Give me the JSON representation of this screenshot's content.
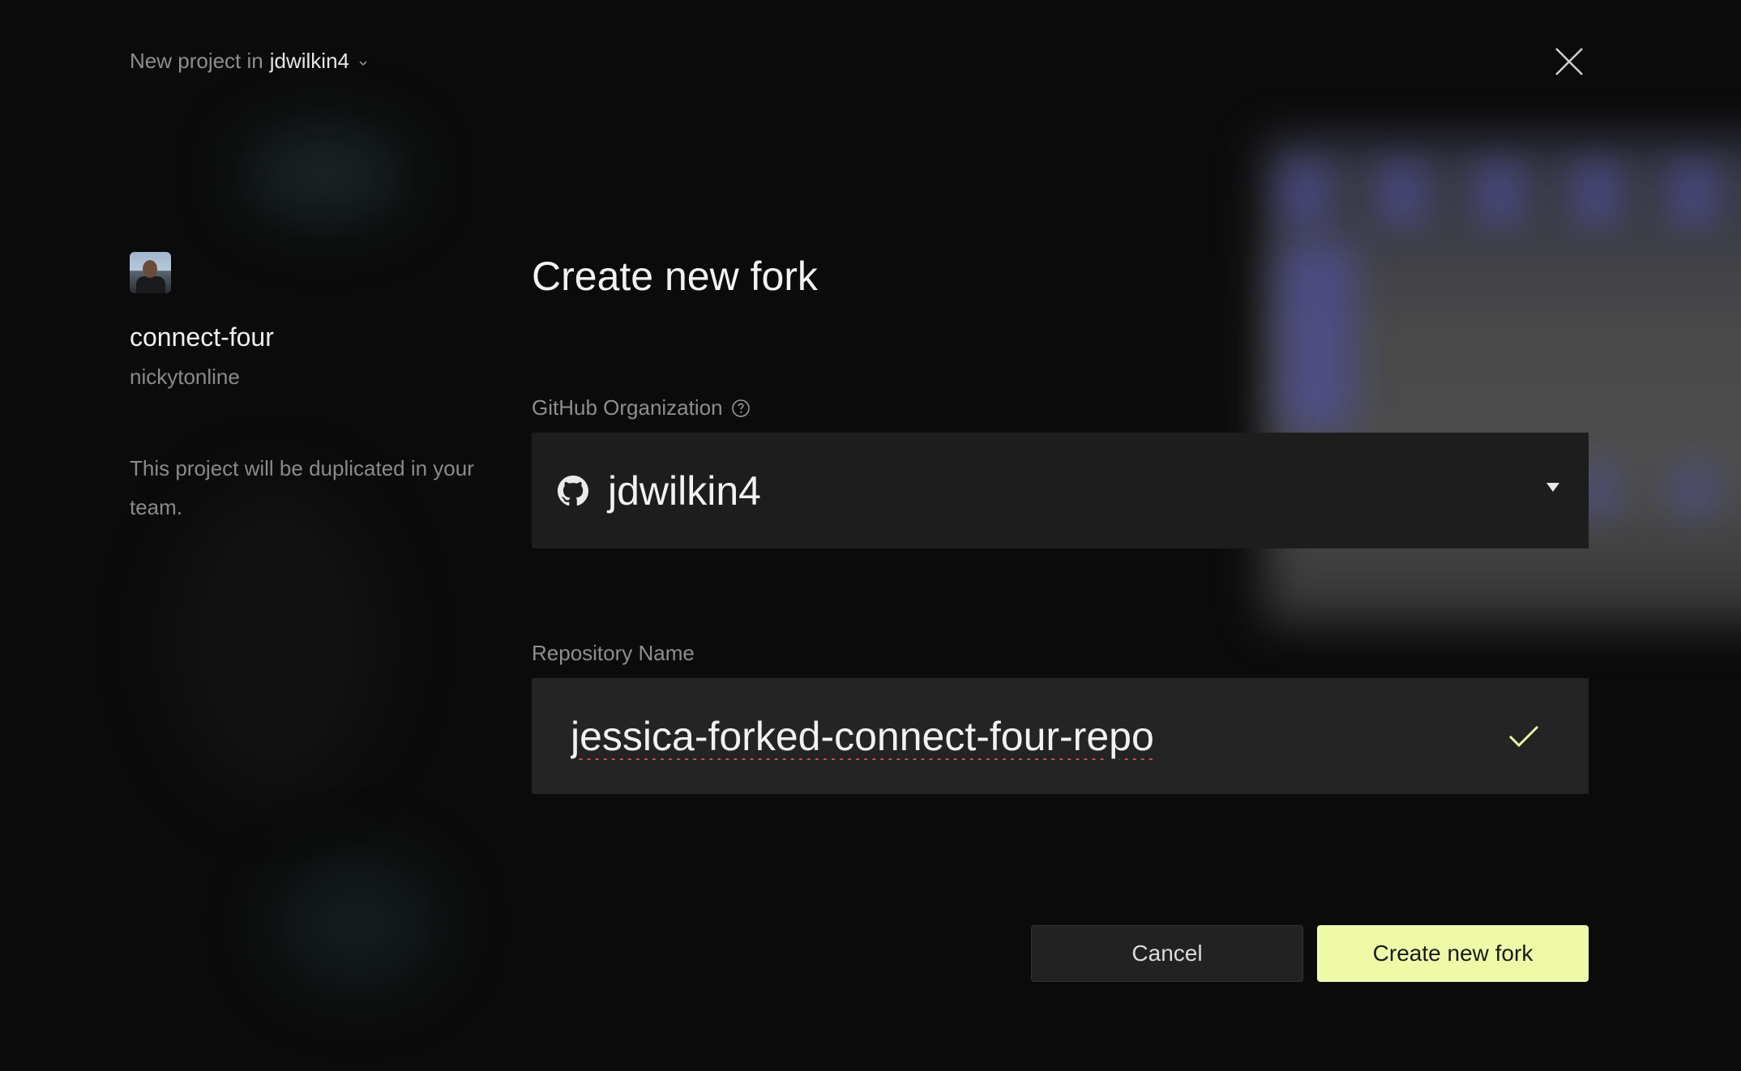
{
  "header": {
    "prefix": "New project in",
    "team": "jdwilkin4"
  },
  "project": {
    "name": "connect-four",
    "owner": "nickytonline",
    "note": "This project will be duplicated in your team."
  },
  "form": {
    "title": "Create new fork",
    "org_label": "GitHub Organization",
    "org_value": "jdwilkin4",
    "repo_label": "Repository Name",
    "repo_value": "jessica-forked-connect-four-repo"
  },
  "buttons": {
    "cancel": "Cancel",
    "create": "Create new fork"
  },
  "colors": {
    "accent": "#eefaa8",
    "background": "#0b0b0b",
    "field_bg": "#1d1d1d",
    "check": "#e8f5a8",
    "spell_error": "#d9534f"
  },
  "icons": {
    "team_dropdown": "chevron-down-icon",
    "close": "close-icon",
    "help": "question-circle-icon",
    "org": "github-icon",
    "select_caret": "caret-down-icon",
    "valid": "checkmark-icon"
  }
}
